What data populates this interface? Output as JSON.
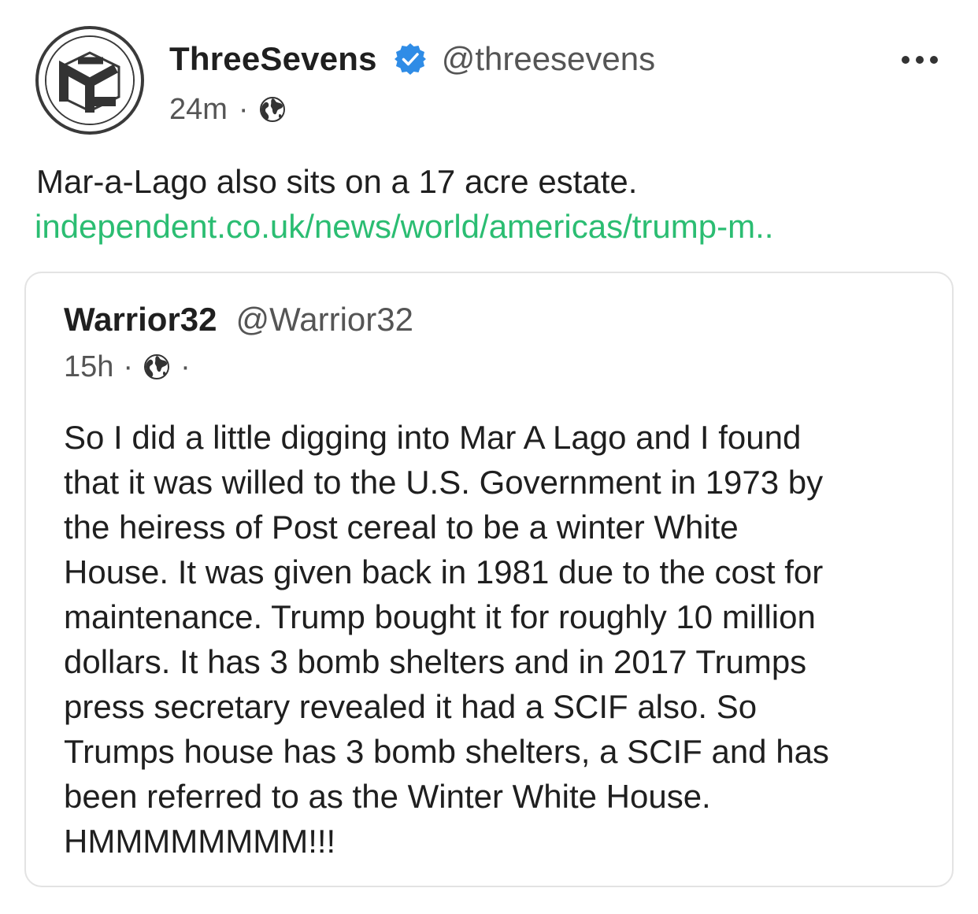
{
  "post": {
    "author": {
      "display_name": "ThreeSevens",
      "handle": "@threesevens",
      "verified": true,
      "avatar_icon": "cube-logo-icon"
    },
    "time": "24m",
    "separator": "·",
    "visibility_icon": "globe-icon",
    "more_icon": "more-horizontal-icon",
    "text": "Mar-a-Lago also sits on a 17 acre estate.",
    "link": "independent.co.uk/news/world/americas/trump-m..",
    "colors": {
      "link": "#2bbd72",
      "verified": "#2f8ce6",
      "text": "#1f1f1f",
      "muted": "#555555",
      "card_border": "#e3e3e3"
    }
  },
  "quote": {
    "author": {
      "display_name": "Warrior32",
      "handle": "@Warrior32"
    },
    "time": "15h",
    "separator": "·",
    "trailing_separator": "·",
    "visibility_icon": "globe-icon",
    "lines": [
      "So I did a little digging into Mar A Lago and I found",
      "that it was willed to the U.S. Government in 1973 by",
      "the heiress of Post cereal to be a winter White",
      "House. It was given back in 1981 due to the cost for",
      "maintenance. Trump bought it for roughly 10 million",
      "dollars. It has 3 bomb shelters and in 2017 Trumps",
      "press secretary revealed it had a SCIF also. So",
      "Trumps house has 3 bomb shelters, a SCIF and has",
      "been referred to as the Winter White House.",
      "HMMMMMMMM!!!"
    ]
  }
}
